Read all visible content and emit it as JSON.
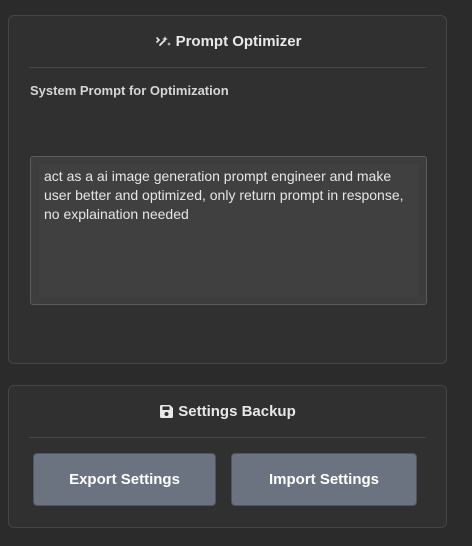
{
  "optimizer": {
    "title": "Prompt Optimizer",
    "icon": "sparkle-icon",
    "system_prompt_label": "System Prompt for Optimization",
    "system_prompt_value": "act as a ai image generation prompt engineer and make user better and optimized, only return prompt in response, no explaination needed"
  },
  "backup": {
    "title": "Settings Backup",
    "icon": "floppy-disk-icon",
    "export_label": "Export Settings",
    "import_label": "Import Settings"
  },
  "colors": {
    "background": "#2b2b2b",
    "panel": "#303030",
    "button": "#6b7380"
  }
}
